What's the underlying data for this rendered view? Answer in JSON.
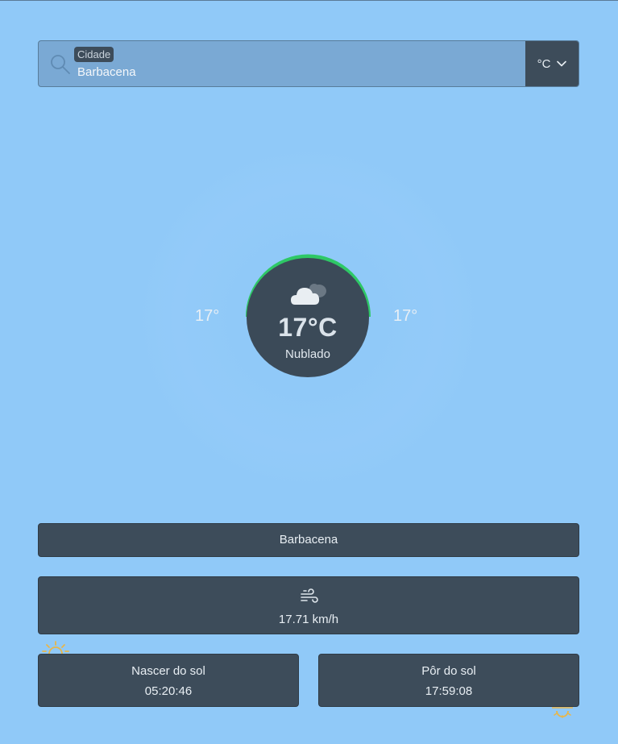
{
  "search": {
    "label": "Cidade",
    "value": "Barbacena",
    "icon": "search-icon"
  },
  "unit_selector": {
    "selected": "°C",
    "icon": "chevron-down-icon"
  },
  "weather": {
    "temperature": "17°C",
    "condition": "Nublado",
    "temp_min": "17°",
    "temp_max": "17°",
    "condition_icon": "cloud-icon",
    "gauge_color": "#2ec866"
  },
  "city": "Barbacena",
  "wind": {
    "icon": "wind-icon",
    "speed": "17.71 km/h"
  },
  "sunrise": {
    "title": "Nascer do sol",
    "time": "05:20:46",
    "icon": "sunrise-icon"
  },
  "sunset": {
    "title": "Pôr do sol",
    "time": "17:59:08",
    "icon": "sunset-icon"
  },
  "colors": {
    "background": "#90c9f8",
    "card": "#3d4c5a",
    "accent_green": "#2ec866",
    "sun_yellow": "#e8b64a"
  }
}
